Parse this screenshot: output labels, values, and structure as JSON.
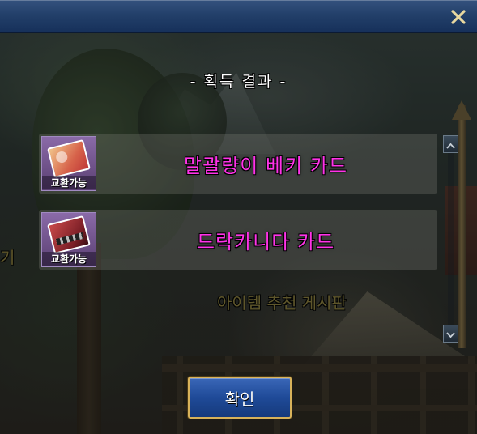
{
  "window": {
    "close_icon": "close-x-icon"
  },
  "background": {
    "board_label": "아이템 추천 게시판",
    "left_label": "기"
  },
  "result": {
    "title": "- 획득 결과 -",
    "items": [
      {
        "name": "말괄량이 베키 카드",
        "badge": "교환가능",
        "icon": "card-icon"
      },
      {
        "name": "드락카니다 카드",
        "badge": "교환가능",
        "icon": "card-icon"
      }
    ]
  },
  "scrollbar": {
    "up_icon": "chevron-up-icon",
    "down_icon": "chevron-down-icon"
  },
  "confirm": {
    "label": "확인"
  },
  "colors": {
    "item_name": "#ff33e8",
    "titlebar": "#23406a",
    "button": "#1f4a98",
    "button_border": "#d8b25a"
  }
}
